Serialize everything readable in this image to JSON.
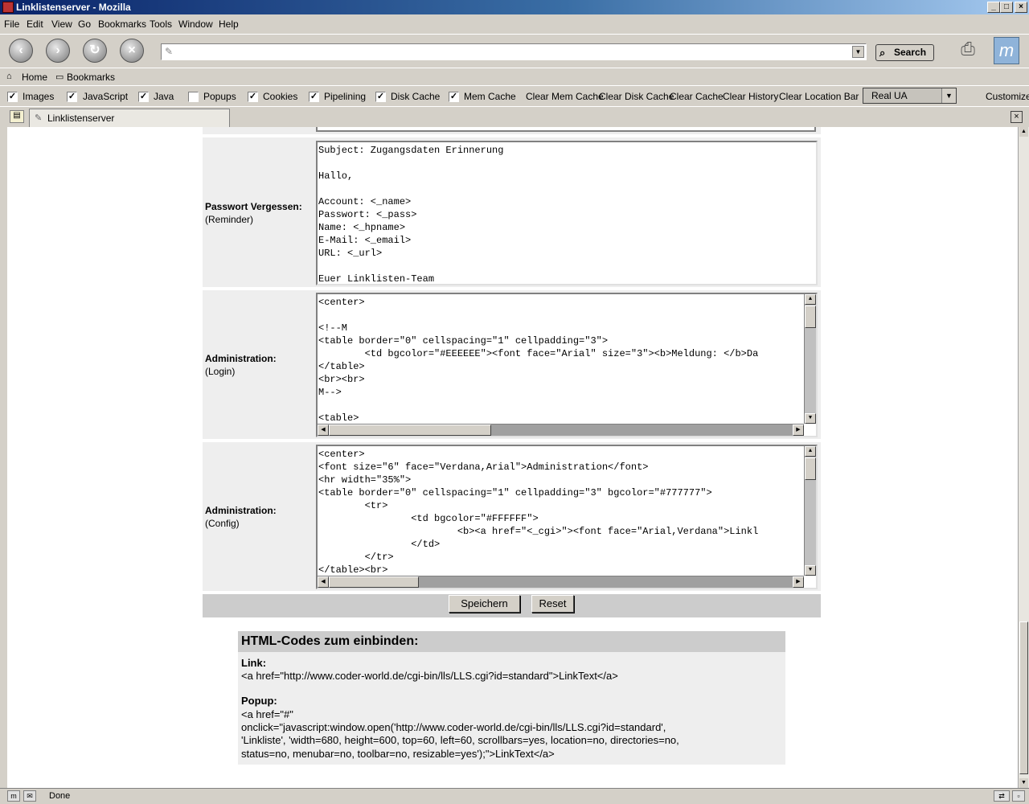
{
  "window": {
    "title": "Linklistenserver - Mozilla",
    "buttons": {
      "minimize": "_",
      "maximize": "□",
      "close": "×"
    }
  },
  "menu": [
    "File",
    "Edit",
    "View",
    "Go",
    "Bookmarks",
    "Tools",
    "Window",
    "Help"
  ],
  "navbar": {
    "url_value": "",
    "search_label": "Search"
  },
  "personal": {
    "home": "Home",
    "bookmarks": "Bookmarks"
  },
  "prefbar": {
    "checks": [
      {
        "label": "Images",
        "checked": "✓"
      },
      {
        "label": "JavaScript",
        "checked": "✓"
      },
      {
        "label": "Java",
        "checked": "✓"
      },
      {
        "label": "Popups",
        "checked": ""
      },
      {
        "label": "Cookies",
        "checked": "✓"
      },
      {
        "label": "Pipelining",
        "checked": "✓"
      },
      {
        "label": "Disk Cache",
        "checked": "✓"
      },
      {
        "label": "Mem Cache",
        "checked": "✓"
      }
    ],
    "buttons": [
      "Clear Mem Cache",
      "Clear Disk Cache",
      "Clear Cache",
      "Clear History",
      "Clear Location Bar"
    ],
    "ua_selected": "Real UA",
    "customize": "Customize"
  },
  "tab": {
    "title": "Linklistenserver"
  },
  "form": {
    "reminder": {
      "label": "Passwort Vergessen:",
      "sub": "(Reminder)",
      "lines": [
        "Subject: Zugangsdaten Erinnerung",
        "",
        "Hallo,",
        "",
        "Account: <_name>",
        "Passwort: <_pass>",
        "Name: <_hpname>",
        "E-Mail: <_email>",
        "URL: <_url>",
        "",
        "Euer Linklisten-Team"
      ]
    },
    "login": {
      "label": "Administration:",
      "sub": "(Login)",
      "lines": [
        "<center>",
        "",
        "<!--M",
        "<table border=\"0\" cellspacing=\"1\" cellpadding=\"3\">",
        "        <td bgcolor=\"#EEEEEE\"><font face=\"Arial\" size=\"3\"><b>Meldung: </b>Da",
        "</table>",
        "<br><br>",
        "M-->",
        "",
        "<table>"
      ]
    },
    "config": {
      "label": "Administration:",
      "sub": "(Config)",
      "lines": [
        "<center>",
        "<font size=\"6\" face=\"Verdana,Arial\">Administration</font>",
        "<hr width=\"35%\">",
        "<table border=\"0\" cellspacing=\"1\" cellpadding=\"3\" bgcolor=\"#777777\">",
        "        <tr>",
        "                <td bgcolor=\"#FFFFFF\">",
        "                        <b><a href=\"<_cgi>\"><font face=\"Arial,Verdana\">Linkl",
        "                </td>",
        "        </tr>",
        "</table><br>"
      ]
    },
    "save_label": "Speichern",
    "reset_label": "Reset"
  },
  "codes": {
    "heading": "HTML-Codes zum einbinden:",
    "link_label": "Link:",
    "link_code": "<a href=\"http://www.coder-world.de/cgi-bin/lls/LLS.cgi?id=standard\">LinkText</a>",
    "popup_label": "Popup:",
    "popup_code": [
      "<a href=\"#\"",
      "onclick=\"javascript:window.open('http://www.coder-world.de/cgi-bin/lls/LLS.cgi?id=standard',",
      "'Linkliste', 'width=680, height=600, top=60, left=60, scrollbars=yes, location=no, directories=no,",
      "status=no, menubar=no, toolbar=no, resizable=yes');\">LinkText</a>"
    ]
  },
  "status": {
    "text": "Done"
  },
  "colors": {
    "titlebar": "#0a246a",
    "panel": "#eeeeee",
    "header": "#cccccc"
  }
}
